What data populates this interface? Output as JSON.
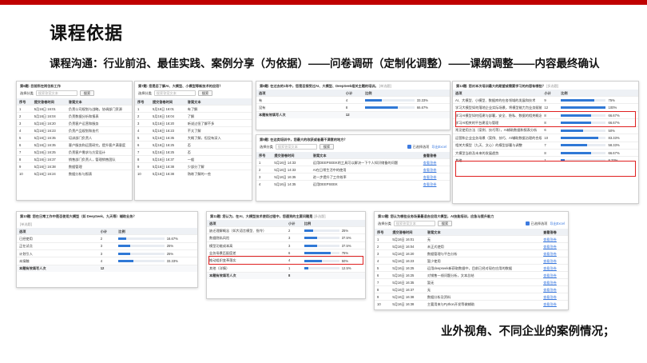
{
  "header": {
    "title": "课程依据",
    "subtitle": "课程沟通：行业前沿、最佳实践、案例分享（为依据）——问卷调研（定制化调整）——课纲调整——内容最终确认",
    "footer": "业外视角、不同企业的案例情况；"
  },
  "common": {
    "search_placeholder": "搜索答案文本",
    "search_btn": "搜索",
    "filter_label": "选择分类",
    "col_idx": "序号",
    "col_time": "提交答卷时间",
    "col_text": "答案文本",
    "col_view": "查看答卷",
    "col_option": "选项",
    "col_count": "小计",
    "col_ratio": "比例",
    "view_link": "查看答卷",
    "total_label": "本题有效填写人次",
    "show_options": "已选择选项",
    "export": "导出Excel",
    "hint": "[单选题]",
    "hint_multi": "[多选题]"
  },
  "panel1": {
    "question": "第6题: 目前所在岗位和工作",
    "rows": [
      {
        "idx": "1",
        "time": "5月16日 16:01",
        "text": "负责公司规划与战略，协调部门资源"
      },
      {
        "idx": "2",
        "time": "5月16日 16:04",
        "text": "负责数据分析和报表"
      },
      {
        "idx": "3",
        "time": "5月16日 16:20",
        "text": "负责客户运营和服务"
      },
      {
        "idx": "4",
        "time": "5月16日 16:23",
        "text": "负责产品规划和迭代"
      },
      {
        "idx": "5",
        "time": "5月16日 16:35",
        "text": "培训部门负责人"
      },
      {
        "idx": "6",
        "time": "5月16日 16:35",
        "text": "客户服务和运营研究，提升客户满意度"
      },
      {
        "idx": "7",
        "time": "5月16日 16:25",
        "text": "负责客户需求与方案设计"
      },
      {
        "idx": "8",
        "time": "5月16日 16:37",
        "text": "销售部门负责人，管理销售团队"
      },
      {
        "idx": "9",
        "time": "5月16日 16:38",
        "text": "数据管理"
      },
      {
        "idx": "10",
        "time": "5月16日 16:24",
        "text": "数据分析与报表"
      }
    ]
  },
  "panel2": {
    "question": "第7题: 您是否了解AI、大模型、小模型等新技术的应用？",
    "rows": [
      {
        "idx": "1",
        "time": "5月16日 16:01",
        "text": "有了解"
      },
      {
        "idx": "2",
        "time": "5月16日 16:04",
        "text": "了解"
      },
      {
        "idx": "3",
        "time": "5月16日 16:20",
        "text": "听说过但了解不多"
      },
      {
        "idx": "4",
        "time": "5月16日 16:23",
        "text": "不太了解"
      },
      {
        "idx": "5",
        "time": "5月16日 16:35",
        "text": "大概了解，但没有深入"
      },
      {
        "idx": "6",
        "time": "5月16日 16:25",
        "text": "否"
      },
      {
        "idx": "7",
        "time": "5月16日 16:25",
        "text": "否"
      },
      {
        "idx": "8",
        "time": "5月16日 16:37",
        "text": "一般"
      },
      {
        "idx": "9",
        "time": "5月16日 16:38",
        "text": "少部分了解"
      },
      {
        "idx": "10",
        "time": "5月16日 16:38",
        "text": "熟练了解的一些"
      }
    ]
  },
  "panel3": {
    "question": "第8题: 在过去的1年中，您是否接受过AI、大模型、DeepSeek相关主题的培训。",
    "rows": [
      {
        "option": "有",
        "count": "4",
        "ratio": 0.3333,
        "label": "33.33%"
      },
      {
        "option": "没有",
        "count": "8",
        "ratio": 0.6667,
        "label": "66.67%"
      }
    ],
    "total": "12"
  },
  "panel4": {
    "question": "第9题: 在这类培训中，您最大的收获或者最不满意的地方？",
    "rows": [
      {
        "idx": "1",
        "time": "5月16日 14:33",
        "text": "运用DEEPSEEK的工具可以解决一下个人知识储备的问题"
      },
      {
        "idx": "2",
        "time": "5月16日 14:33",
        "text": "AI在日常生活中的使用"
      },
      {
        "idx": "3",
        "time": "5月16日 16:35",
        "text": "进一步提升了工作效率"
      },
      {
        "idx": "4",
        "time": "5月16日 14:35",
        "text": "运用DEEPSEEK"
      }
    ]
  },
  "panel5": {
    "question": "第10题: 您在日常工作中是否使用大模型（如 DeepSeek、九天等）辅助业务？",
    "rows": [
      {
        "option": "已经使用",
        "count": "2",
        "ratio": 0.1667,
        "label": "16.67%"
      },
      {
        "option": "正在试点",
        "count": "3",
        "ratio": 0.25,
        "label": "25%"
      },
      {
        "option": "计划引入",
        "count": "3",
        "ratio": 0.25,
        "label": "25%"
      },
      {
        "option": "未接触",
        "count": "4",
        "ratio": 0.3333,
        "label": "33.33%"
      }
    ],
    "total": "12"
  },
  "panel6": {
    "question": "第11题: 您认为，在AI、大模型技术使用过程中，您遇到的主要问题是",
    "rows": [
      {
        "option": "缺乏理解概念（如大语言模型、指令）",
        "count": "2",
        "ratio": 0.25,
        "label": "25%"
      },
      {
        "option": "数据隐私风险",
        "count": "3",
        "ratio": 0.375,
        "label": "37.5%"
      },
      {
        "option": "模型功能成本高",
        "count": "3",
        "ratio": 0.375,
        "label": "37.5%"
      },
      {
        "option": "业务场景匹配度差",
        "count": "6",
        "ratio": 0.75,
        "label": "75%"
      },
      {
        "option": "推动组织变革落实",
        "count": "4",
        "ratio": 0.5,
        "label": "50%"
      },
      {
        "option": "其他（详情）",
        "count": "1",
        "ratio": 0.125,
        "label": "12.5%"
      }
    ],
    "total": "8"
  },
  "panel7": {
    "question": "第12题: 您认为哪些业务场景最适合应用大模型，AI技能培训，应急与提升能力",
    "rows": [
      {
        "idx": "1",
        "time": "5月16日 16:01",
        "text": "无"
      },
      {
        "idx": "2",
        "time": "5月16日 16:04",
        "text": "未正式使用"
      },
      {
        "idx": "3",
        "time": "5月16日 16:20",
        "text": "数据管理与平台分析"
      },
      {
        "idx": "4",
        "time": "5月16日 16:23",
        "text": "暂少使用"
      },
      {
        "idx": "5",
        "time": "5月16日 16:25",
        "text": "运用deepseek新获取数据中，目前已经对现在应用的数据"
      },
      {
        "idx": "6",
        "time": "5月16日 16:25",
        "text": "对销售一线问题分析，文本总结"
      },
      {
        "idx": "7",
        "time": "5月16日 16:35",
        "text": "暂无"
      },
      {
        "idx": "8",
        "time": "5月16日 16:37",
        "text": "无"
      },
      {
        "idx": "9",
        "time": "5月16日 16:38",
        "text": "数据分析及资料"
      },
      {
        "idx": "10",
        "time": "5月16日 16:38",
        "text": "主要用来与Python开发等做辅助"
      }
    ]
  },
  "panel8": {
    "question": "第13题: 您对本次培训最大的期望或需要学习的内容有哪些？",
    "rows": [
      {
        "option": "AI、大模型、小模型、数据库的在各领域的发展和技术",
        "count": "9",
        "ratio": 0.75,
        "label": "75%"
      },
      {
        "option": "学习大模型如何落地企业实际场景，将模型能力为业务赋能",
        "count": "12",
        "ratio": 1.0,
        "label": "100%"
      },
      {
        "option": "学习AI模型如何搭建与部署，安全、隐私、数据的相关概念与对应方法",
        "count": "8",
        "ratio": 0.6667,
        "label": "66.67%"
      },
      {
        "option": "学习AI相关的平台建设与管理",
        "count": "8",
        "ratio": 0.6667,
        "label": "66.67%"
      },
      {
        "option": "常见使用方法（案例、技巧等），AI辅助数据和报表分析",
        "count": "6",
        "ratio": 0.5,
        "label": "50%"
      },
      {
        "option": "运营和企业业务场景（案例、技巧、AI辅助数据治理的合规的风险管理）",
        "count": "10",
        "ratio": 0.8333,
        "label": "83.33%"
      },
      {
        "option": "相关大模型（九天、文心）的模型部署与调整",
        "count": "7",
        "ratio": 0.5833,
        "label": "58.33%"
      },
      {
        "option": "大模型当前及未来的发展趋势",
        "count": "8",
        "ratio": 0.6667,
        "label": "66.67%"
      },
      {
        "option": "其他",
        "count": "1",
        "ratio": 0.0833,
        "label": "8.33%"
      }
    ]
  },
  "colors": {
    "accent": "#c00000",
    "bar": "#2f78d6",
    "highlight": "#e02020"
  }
}
